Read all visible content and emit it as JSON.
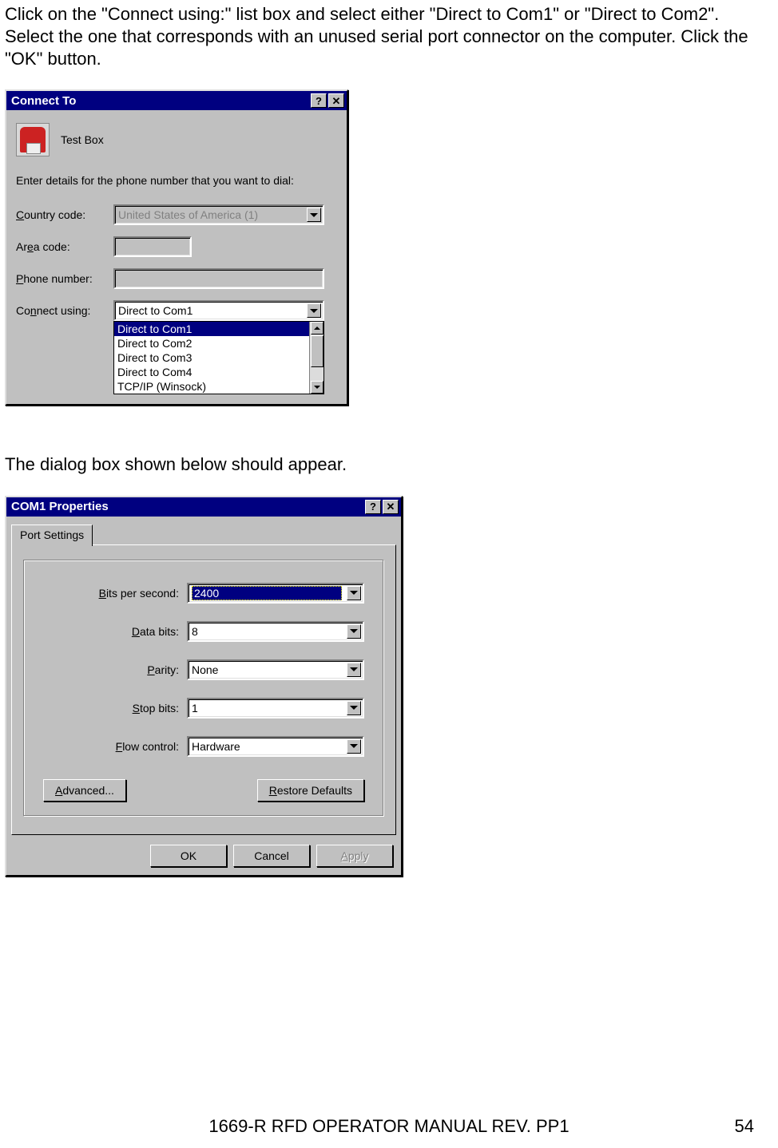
{
  "paragraph1": "Click on the \"Connect using:\" list box and select either \"Direct to Com1\" or \"Direct to Com2\".  Select the one that corresponds with an unused serial port connector on the computer.  Click the \"OK\" button.",
  "paragraph2": "The dialog box shown below should appear.",
  "dlg1": {
    "title": "Connect To",
    "name_value": "Test Box",
    "instruction": "Enter details for the phone number that you want to dial:",
    "country_label": "Country code:",
    "country_value": "United States of America (1)",
    "area_label": "Area code:",
    "area_value": "",
    "phone_label": "Phone number:",
    "phone_value": "",
    "connect_label": "Connect using:",
    "connect_value": "Direct to Com1",
    "options": [
      "Direct to Com1",
      "Direct to Com2",
      "Direct to Com3",
      "Direct to Com4",
      "TCP/IP (Winsock)"
    ]
  },
  "dlg2": {
    "title": "COM1 Properties",
    "tab": "Port Settings",
    "bits_label": "Bits per second:",
    "bits_value": "2400",
    "data_label": "Data bits:",
    "data_value": "8",
    "parity_label": "Parity:",
    "parity_value": "None",
    "stop_label": "Stop bits:",
    "stop_value": "1",
    "flow_label": "Flow control:",
    "flow_value": "Hardware",
    "advanced": "Advanced...",
    "restore": "Restore Defaults",
    "ok": "OK",
    "cancel": "Cancel",
    "apply": "Apply"
  },
  "footer": {
    "text": "1669-R RFD OPERATOR MANUAL REV. PP1",
    "page": "54"
  }
}
